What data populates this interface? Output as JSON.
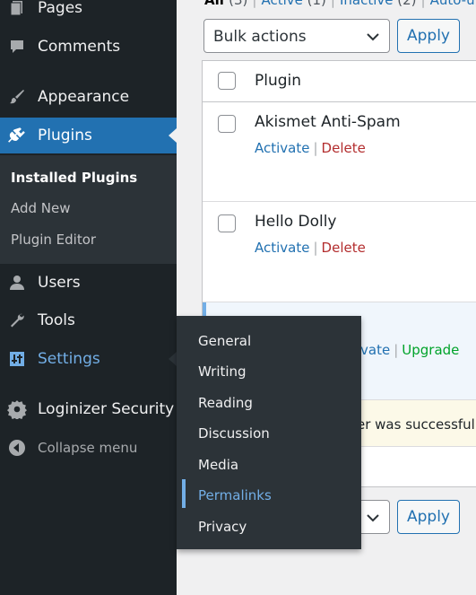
{
  "sidebar": {
    "items": [
      {
        "label": "Pages",
        "icon": "pages-icon"
      },
      {
        "label": "Comments",
        "icon": "comments-icon"
      },
      {
        "label": "Appearance",
        "icon": "paintbrush-icon"
      },
      {
        "label": "Plugins",
        "icon": "plugin-icon"
      },
      {
        "label": "Users",
        "icon": "users-icon"
      },
      {
        "label": "Tools",
        "icon": "wrench-icon"
      },
      {
        "label": "Settings",
        "icon": "sliders-icon"
      },
      {
        "label": "Loginizer Security",
        "icon": "gear-icon"
      }
    ],
    "plugins_submenu": [
      "Installed Plugins",
      "Add New",
      "Plugin Editor"
    ],
    "collapse_label": "Collapse menu"
  },
  "settings_flyout": [
    "General",
    "Writing",
    "Reading",
    "Discussion",
    "Media",
    "Permalinks",
    "Privacy"
  ],
  "views": {
    "all": "All",
    "all_count": "(3)",
    "active": "Active",
    "active_count": "(1)",
    "inactive": "Inactive",
    "inactive_count": "(2)",
    "autoupdates": "Auto-up",
    "separator": "|"
  },
  "bulk_actions": {
    "selected": "Bulk actions",
    "apply_label": "Apply"
  },
  "table": {
    "column_plugin": "Plugin",
    "rows": [
      {
        "name": "Akismet Anti-Spam",
        "activate": "Activate",
        "delete": "Delete"
      },
      {
        "name": "Hello Dolly",
        "activate": "Activate",
        "delete": "Delete"
      }
    ],
    "row3_actions": {
      "activate": "vate",
      "upgrade": "Upgrade"
    },
    "notice_text": "er was successfully"
  },
  "bottom_apply_label": "Apply",
  "colors": {
    "sidebar_bg": "#1d2327",
    "accent": "#2271b1",
    "highlight": "#72aee6",
    "delete": "#b32d2e",
    "upgrade": "#00a32a"
  }
}
